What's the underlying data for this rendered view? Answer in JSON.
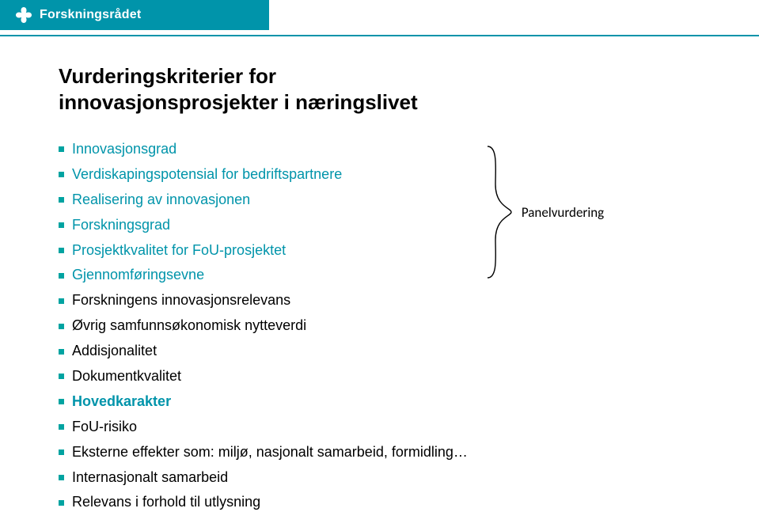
{
  "header": {
    "brand": "Forskningsrådet"
  },
  "title_line1": "Vurderingskriterier for",
  "title_line2": "innovasjonsprosjekter i næringslivet",
  "criteria": {
    "item0": "Innovasjonsgrad",
    "item1": "Verdiskapingspotensial for bedriftspartnere",
    "item2": "Realisering av innovasjonen",
    "item3": "Forskningsgrad",
    "item4": "Prosjektkvalitet for FoU-prosjektet",
    "item5": "Gjennomføringsevne",
    "item6": "Forskningens innovasjonsrelevans",
    "item7": "Øvrig samfunnsøkonomisk nytteverdi",
    "item8": "Addisjonalitet",
    "item9": "Dokumentkvalitet",
    "item10": "Hovedkarakter",
    "item11": "FoU-risiko",
    "item12": "Eksterne effekter som: miljø, nasjonalt samarbeid, formidling…",
    "item13": "Internasjonalt samarbeid",
    "item14": "Relevans i forhold til utlysning"
  },
  "bracket_label": "Panelvurdering"
}
